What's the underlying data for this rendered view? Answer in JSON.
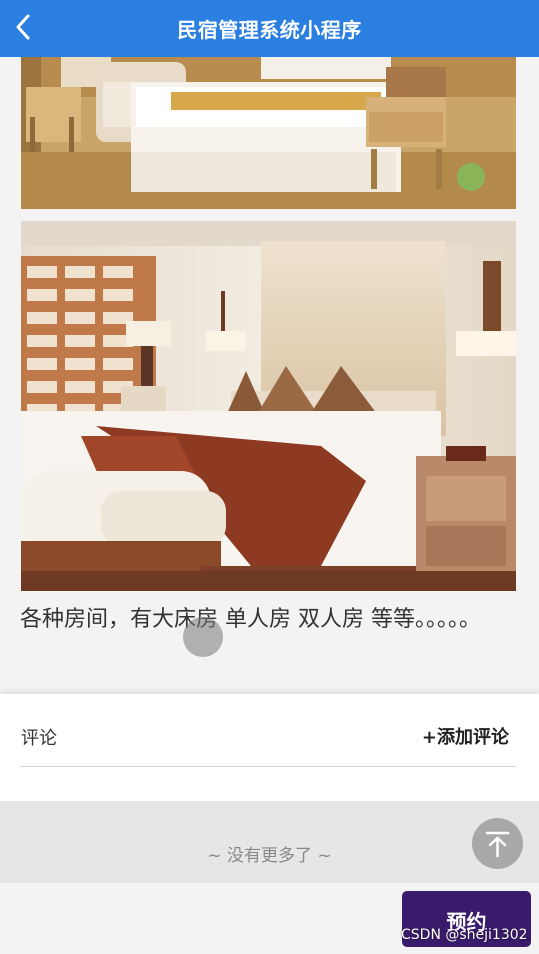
{
  "navbar": {
    "title": "民宿管理系统小程序",
    "back_icon": "chevron-left-icon",
    "color": "#2a7fe0"
  },
  "gallery": {
    "images": [
      {
        "subject": "hotel-room-twin-bed-photo"
      },
      {
        "subject": "hotel-room-double-bed-photo"
      }
    ]
  },
  "room": {
    "description": "各种房间，有大床房 单人房 双人房 等等。。。。。"
  },
  "comments": {
    "label": "评论",
    "add_label": "+添加评论"
  },
  "list": {
    "no_more_text": "~ 没有更多了 ~"
  },
  "actions": {
    "back_to_top_icon": "arrow-up-to-top-icon",
    "book_label": "预约",
    "book_color": "#3a1b6b"
  },
  "watermark": {
    "text": "CSDN @sheji1302"
  }
}
